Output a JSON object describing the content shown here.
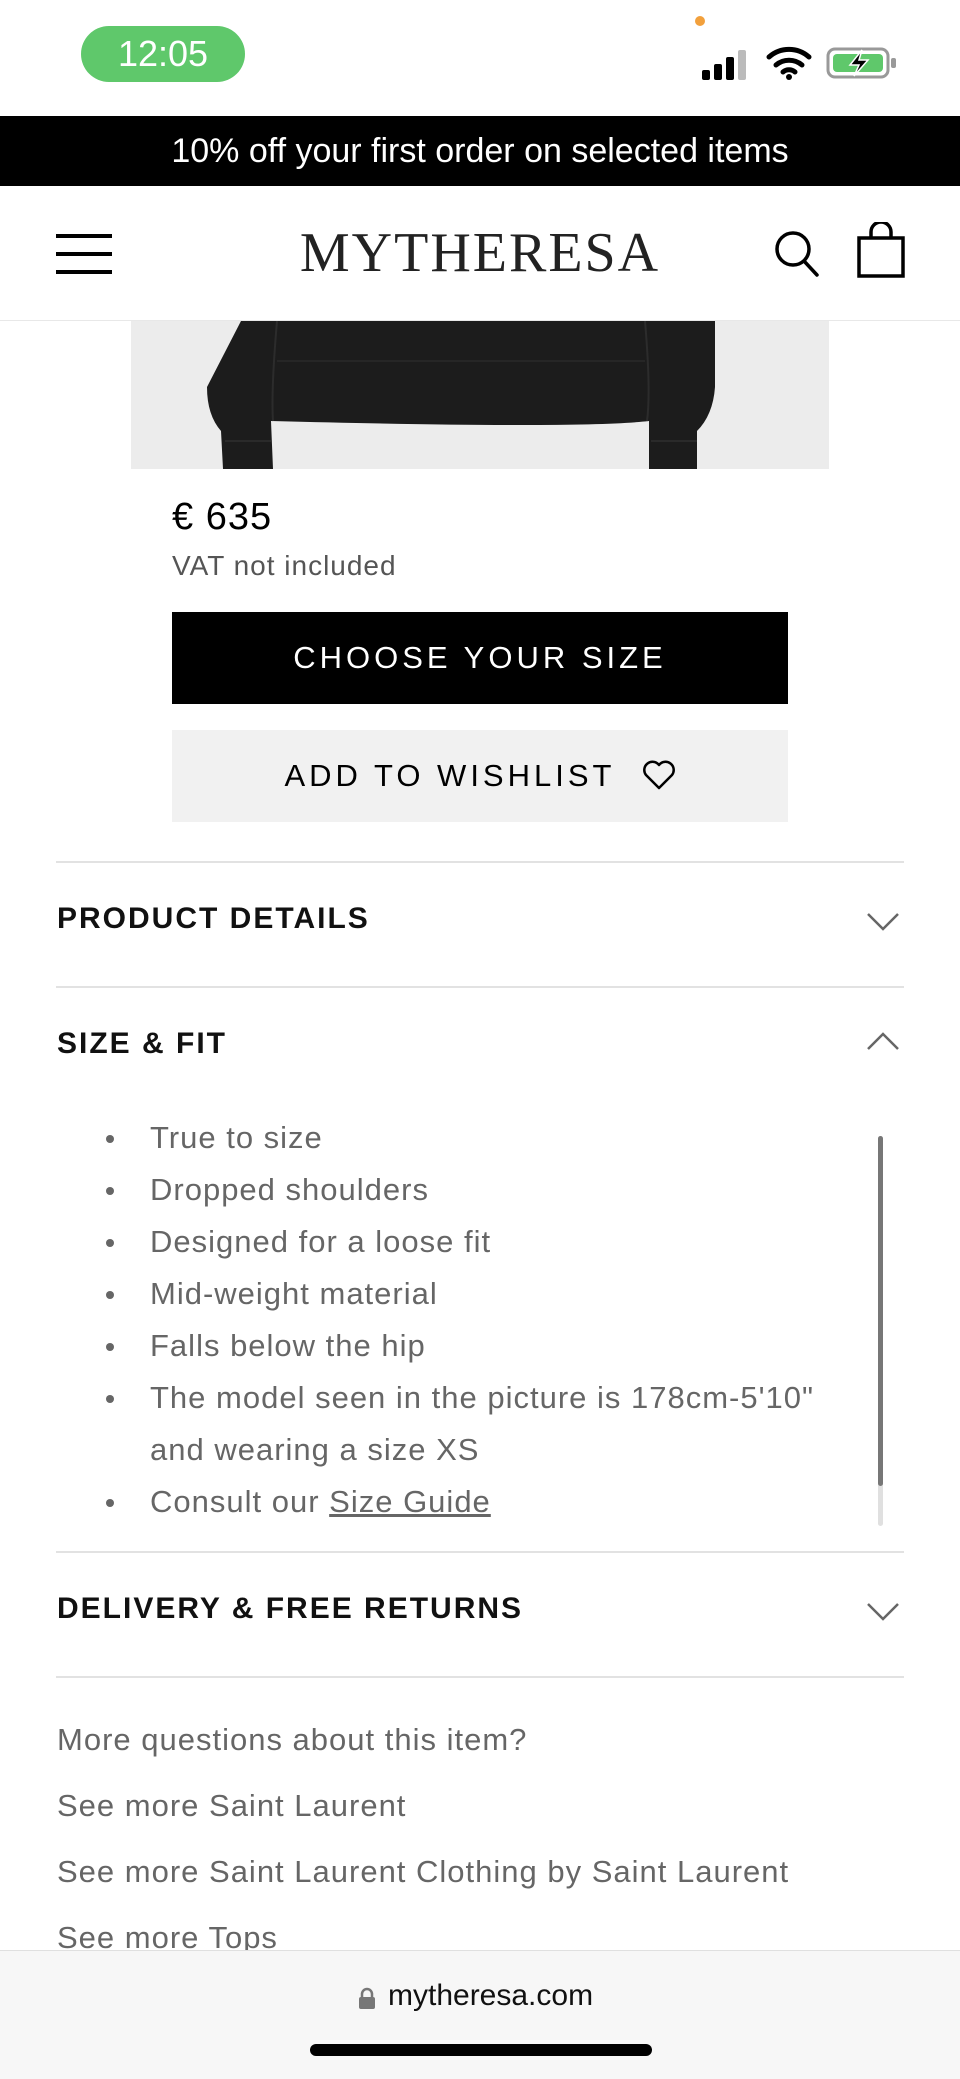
{
  "status_bar": {
    "time": "12:05",
    "icons": [
      "signal-icon",
      "wifi-icon",
      "battery-charging-icon"
    ],
    "time_pill_color": "#5fc86b"
  },
  "promo": {
    "text": "10% off your first order on selected items"
  },
  "header": {
    "logo": "MYTHERESA",
    "icons": [
      "menu-icon",
      "search-icon",
      "bag-icon"
    ]
  },
  "product": {
    "price": "€ 635",
    "vat_note": "VAT not included",
    "choose_size_label": "CHOOSE YOUR SIZE",
    "wishlist_label": "ADD TO WISHLIST"
  },
  "accordion": {
    "product_details": {
      "title": "PRODUCT DETAILS",
      "expanded": false
    },
    "size_fit": {
      "title": "SIZE & FIT",
      "expanded": true,
      "items": [
        "True to size",
        "Dropped shoulders",
        "Designed for a loose fit",
        "Mid-weight material",
        "Falls below the hip",
        "The model seen in the picture is 178cm-5'10\"",
        "and wearing a size XS"
      ],
      "consult_prefix": "Consult our",
      "size_guide_link": "Size Guide"
    },
    "delivery": {
      "title": "DELIVERY & FREE RETURNS",
      "expanded": false
    }
  },
  "more_links": [
    "More questions about this item?",
    "See more Saint Laurent",
    "See more Saint Laurent Clothing by Saint Laurent",
    "See more Tops"
  ],
  "browser": {
    "url": "mytheresa.com"
  }
}
